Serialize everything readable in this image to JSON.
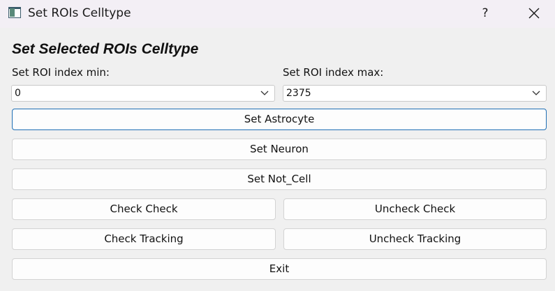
{
  "window": {
    "title": "Set ROIs Celltype",
    "help_label": "?",
    "icons": {
      "app": "app-window-icon",
      "close": "close-icon"
    }
  },
  "heading": "Set Selected ROIs Celltype",
  "index_min": {
    "label": "Set ROI index min:",
    "value": "0"
  },
  "index_max": {
    "label": "Set ROI index max:",
    "value": "2375"
  },
  "buttons": {
    "set_astrocyte": "Set Astrocyte",
    "set_neuron": "Set Neuron",
    "set_not_cell": "Set Not_Cell",
    "check_check": "Check Check",
    "uncheck_check": "Uncheck Check",
    "check_tracking": "Check Tracking",
    "uncheck_tracking": "Uncheck Tracking",
    "exit": "Exit"
  },
  "colors": {
    "focus_border": "#1f6fb5",
    "titlebar_bg": "#f3eff5",
    "window_bg": "#f0f0f0"
  }
}
